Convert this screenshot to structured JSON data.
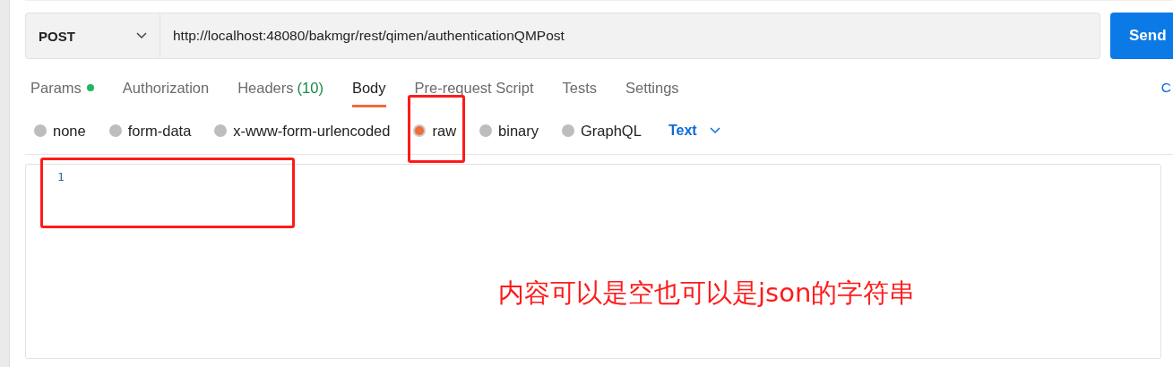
{
  "request": {
    "method": "POST",
    "url": "http://localhost:48080/bakmgr/rest/qimen/authenticationQMPost",
    "send_label": "Send"
  },
  "tabs": [
    {
      "label": "Params",
      "selected": false,
      "has_dot": true
    },
    {
      "label": "Authorization",
      "selected": false,
      "has_dot": false
    },
    {
      "label": "Headers",
      "count": "(10)",
      "selected": false,
      "has_dot": false
    },
    {
      "label": "Body",
      "selected": true,
      "has_dot": false
    },
    {
      "label": "Pre-request Script",
      "selected": false,
      "has_dot": false
    },
    {
      "label": "Tests",
      "selected": false,
      "has_dot": false
    },
    {
      "label": "Settings",
      "selected": false,
      "has_dot": false
    }
  ],
  "side_link": "C",
  "body_types": [
    {
      "label": "none",
      "selected": false
    },
    {
      "label": "form-data",
      "selected": false
    },
    {
      "label": "x-www-form-urlencoded",
      "selected": false
    },
    {
      "label": "raw",
      "selected": true
    },
    {
      "label": "binary",
      "selected": false
    },
    {
      "label": "GraphQL",
      "selected": false
    }
  ],
  "format": "Text",
  "editor": {
    "line_numbers": [
      "1"
    ]
  },
  "annotation": "内容可以是空也可以是json的字符串"
}
